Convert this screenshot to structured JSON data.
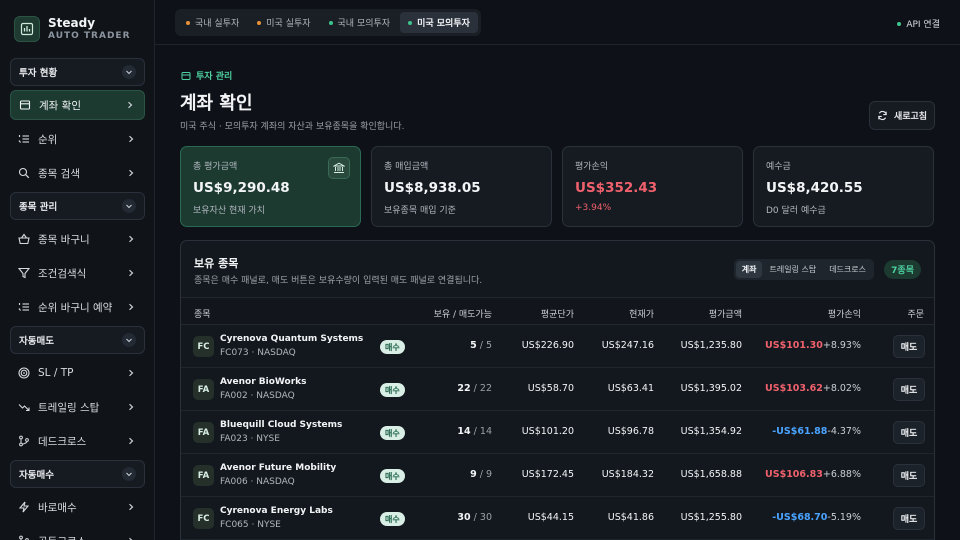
{
  "brand": {
    "name": "Steady",
    "tagline": "AUTO TRADER"
  },
  "sidebar": {
    "sections": [
      {
        "title": "투자 현황",
        "items": [
          {
            "label": "계좌 확인",
            "icon": "wallet-icon",
            "active": true
          },
          {
            "label": "순위",
            "icon": "list-ordered-icon"
          },
          {
            "label": "종목 검색",
            "icon": "search-icon"
          }
        ]
      },
      {
        "title": "종목 관리",
        "items": [
          {
            "label": "종목 바구니",
            "icon": "basket-icon"
          },
          {
            "label": "조건검색식",
            "icon": "filter-icon"
          },
          {
            "label": "순위 바구니 예약",
            "icon": "list-ordered-icon"
          }
        ]
      },
      {
        "title": "자동매도",
        "items": [
          {
            "label": "SL / TP",
            "icon": "target-icon"
          },
          {
            "label": "트레일링 스탑",
            "icon": "trending-down-icon"
          },
          {
            "label": "데드크로스",
            "icon": "git-branch-icon"
          }
        ]
      },
      {
        "title": "자동매수",
        "items": [
          {
            "label": "바로매수",
            "icon": "zap-icon"
          },
          {
            "label": "골든크로스",
            "icon": "git-branch-icon"
          }
        ]
      }
    ]
  },
  "topbar": {
    "tabs": [
      {
        "label": "국내 실투자",
        "dot": "#e8913a",
        "active": false
      },
      {
        "label": "미국 실투자",
        "dot": "#e8913a",
        "active": false
      },
      {
        "label": "국내 모의투자",
        "dot": "#3fc38d",
        "active": false
      },
      {
        "label": "미국 모의투자",
        "dot": "#3fc38d",
        "active": true
      }
    ],
    "api_label": "API 연결",
    "api_dot": "#3fc38d"
  },
  "page": {
    "breadcrumb": "투자 관리",
    "title": "계좌 확인",
    "subtitle": "미국 주식 · 모의투자 계좌의 자산과 보유종목을 확인합니다.",
    "refresh_label": "새로고침"
  },
  "cards": [
    {
      "label": "총 평가금액",
      "value": "US$9,290.48",
      "sub": "보유자산 현재 가치",
      "highlight": true
    },
    {
      "label": "총 매입금액",
      "value": "US$8,938.05",
      "sub": "보유종목 매입 기준"
    },
    {
      "label": "평가손익",
      "value": "US$352.43",
      "sub": "+3.94%",
      "tone": "red"
    },
    {
      "label": "예수금",
      "value": "US$8,420.55",
      "sub": "D0 달러 예수금"
    }
  ],
  "holdings": {
    "title": "보유 종목",
    "desc": "종목은 매수 패널로, 매도 버튼은 보유수량이 입력된 매도 패널로 연결됩니다.",
    "segments": [
      {
        "label": "계좌",
        "on": true
      },
      {
        "label": "트레일링 스탑",
        "on": false
      },
      {
        "label": "데드크로스",
        "on": false
      }
    ],
    "count": "7종목",
    "columns": {
      "name": "종목",
      "qty": "보유 / 매도가능",
      "avg": "평균단가",
      "price": "현재가",
      "value": "평가금액",
      "pl": "평가손익",
      "order": "주문"
    },
    "buy_label": "매수",
    "sell_label": "매도",
    "rows": [
      {
        "tk": "FC",
        "name": "Cyrenova Quantum Systems",
        "code": "FC073 · NASDAQ",
        "qty": "5",
        "avail": "5",
        "avg": "US$226.90",
        "price": "US$247.16",
        "value": "US$1,235.80",
        "pl": "US$101.30",
        "pct": "+8.93%",
        "tone": "red"
      },
      {
        "tk": "FA",
        "name": "Avenor BioWorks",
        "code": "FA002 · NASDAQ",
        "qty": "22",
        "avail": "22",
        "avg": "US$58.70",
        "price": "US$63.41",
        "value": "US$1,395.02",
        "pl": "US$103.62",
        "pct": "+8.02%",
        "tone": "red"
      },
      {
        "tk": "FA",
        "name": "Bluequill Cloud Systems",
        "code": "FA023 · NYSE",
        "qty": "14",
        "avail": "14",
        "avg": "US$101.20",
        "price": "US$96.78",
        "value": "US$1,354.92",
        "pl": "-US$61.88",
        "pct": "-4.37%",
        "tone": "blue"
      },
      {
        "tk": "FA",
        "name": "Avenor Future Mobility",
        "code": "FA006 · NASDAQ",
        "qty": "9",
        "avail": "9",
        "avg": "US$172.45",
        "price": "US$184.32",
        "value": "US$1,658.88",
        "pl": "US$106.83",
        "pct": "+6.88%",
        "tone": "red"
      },
      {
        "tk": "FC",
        "name": "Cyrenova Energy Labs",
        "code": "FC065 · NYSE",
        "qty": "30",
        "avail": "30",
        "avg": "US$44.15",
        "price": "US$41.86",
        "value": "US$1,255.80",
        "pl": "-US$68.70",
        "pct": "-5.19%",
        "tone": "blue"
      }
    ]
  },
  "colors": {
    "accent": "#4ed1a0",
    "gain": "#f0616d",
    "loss": "#4aa3ff",
    "background": "#0e1117"
  }
}
